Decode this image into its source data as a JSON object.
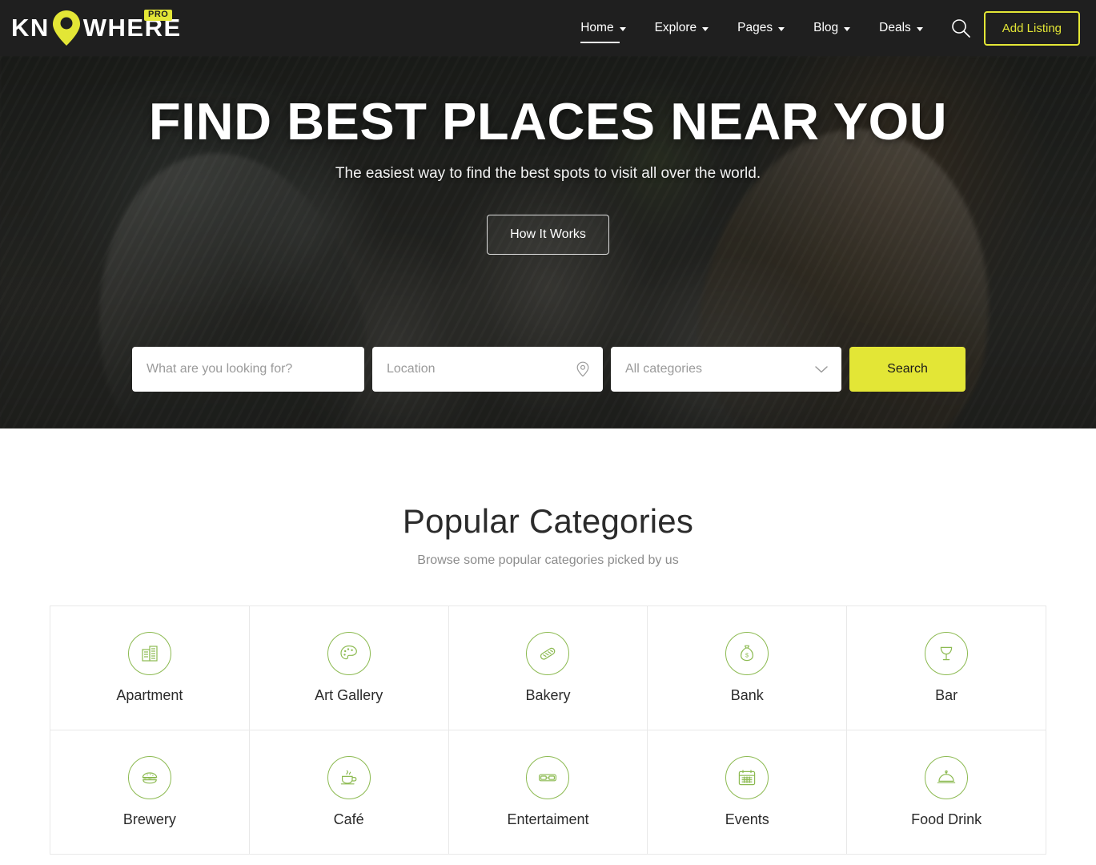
{
  "brand": {
    "name_part1": "KN",
    "name_part2": "WHERE",
    "badge": "PRO",
    "accent_color": "#e3e636",
    "header_bg": "#1f1f1f"
  },
  "nav": {
    "items": [
      {
        "label": "Home",
        "has_caret": true,
        "active": true
      },
      {
        "label": "Explore",
        "has_caret": true,
        "active": false
      },
      {
        "label": "Pages",
        "has_caret": true,
        "active": false
      },
      {
        "label": "Blog",
        "has_caret": true,
        "active": false
      },
      {
        "label": "Deals",
        "has_caret": true,
        "active": false
      }
    ],
    "search_icon": "search-icon",
    "add_listing_label": "Add Listing"
  },
  "hero": {
    "title": "FIND BEST PLACES NEAR YOU",
    "subtitle": "The easiest way to find the best spots to visit all over the world.",
    "cta_label": "How It Works"
  },
  "search": {
    "keyword_placeholder": "What are you looking for?",
    "keyword_value": "",
    "location_placeholder": "Location",
    "location_value": "",
    "location_icon": "map-pin-icon",
    "category_selected": "All categories",
    "category_icon": "chevron-down-icon",
    "button_label": "Search",
    "button_color": "#e3e636"
  },
  "categories_section": {
    "title": "Popular Categories",
    "subtitle": "Browse some popular categories picked by us",
    "icon_color": "#8cba51",
    "items": [
      {
        "label": "Apartment",
        "icon": "building-icon"
      },
      {
        "label": "Art Gallery",
        "icon": "palette-icon"
      },
      {
        "label": "Bakery",
        "icon": "bread-icon"
      },
      {
        "label": "Bank",
        "icon": "money-bag-icon"
      },
      {
        "label": "Bar",
        "icon": "cocktail-glass-icon"
      },
      {
        "label": "Brewery",
        "icon": "burger-icon"
      },
      {
        "label": "Café",
        "icon": "coffee-cup-icon"
      },
      {
        "label": "Entertaiment",
        "icon": "3d-glasses-icon"
      },
      {
        "label": "Events",
        "icon": "calendar-icon"
      },
      {
        "label": "Food Drink",
        "icon": "food-cloche-icon"
      }
    ]
  }
}
